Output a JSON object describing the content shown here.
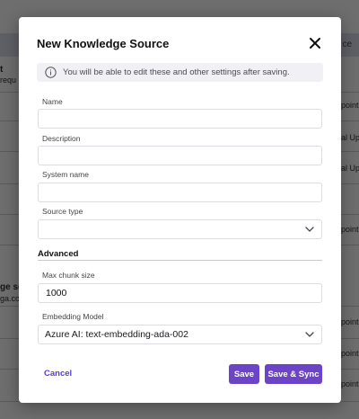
{
  "background": {
    "header_text": "ce",
    "fragments": [
      "t",
      "requ",
      "point",
      "al Up",
      "al Up",
      "point",
      "ge so",
      "ga.co",
      "point",
      "point",
      "point"
    ]
  },
  "modal": {
    "title": "New Knowledge Source",
    "close_icon": "close-icon",
    "info": {
      "icon": "info-icon",
      "text": "You will be able to edit these and other settings after saving."
    },
    "fields": {
      "name": {
        "label": "Name",
        "value": "",
        "placeholder": ""
      },
      "description": {
        "label": "Description",
        "value": "",
        "placeholder": ""
      },
      "system_name": {
        "label": "System name",
        "value": "",
        "placeholder": ""
      },
      "source_type": {
        "label": "Source type",
        "value": ""
      }
    },
    "advanced": {
      "heading": "Advanced",
      "max_chunk_size": {
        "label": "Max chunk size",
        "value": "1000"
      },
      "embedding_model": {
        "label": "Embedding Model",
        "value": "Azure AI: text-embedding-ada-002"
      }
    },
    "actions": {
      "cancel": "Cancel",
      "save": "Save",
      "save_sync": "Save & Sync"
    },
    "colors": {
      "accent": "#6b44c7",
      "link": "#5b3cc4",
      "info_bg": "#f1f0f4"
    }
  }
}
